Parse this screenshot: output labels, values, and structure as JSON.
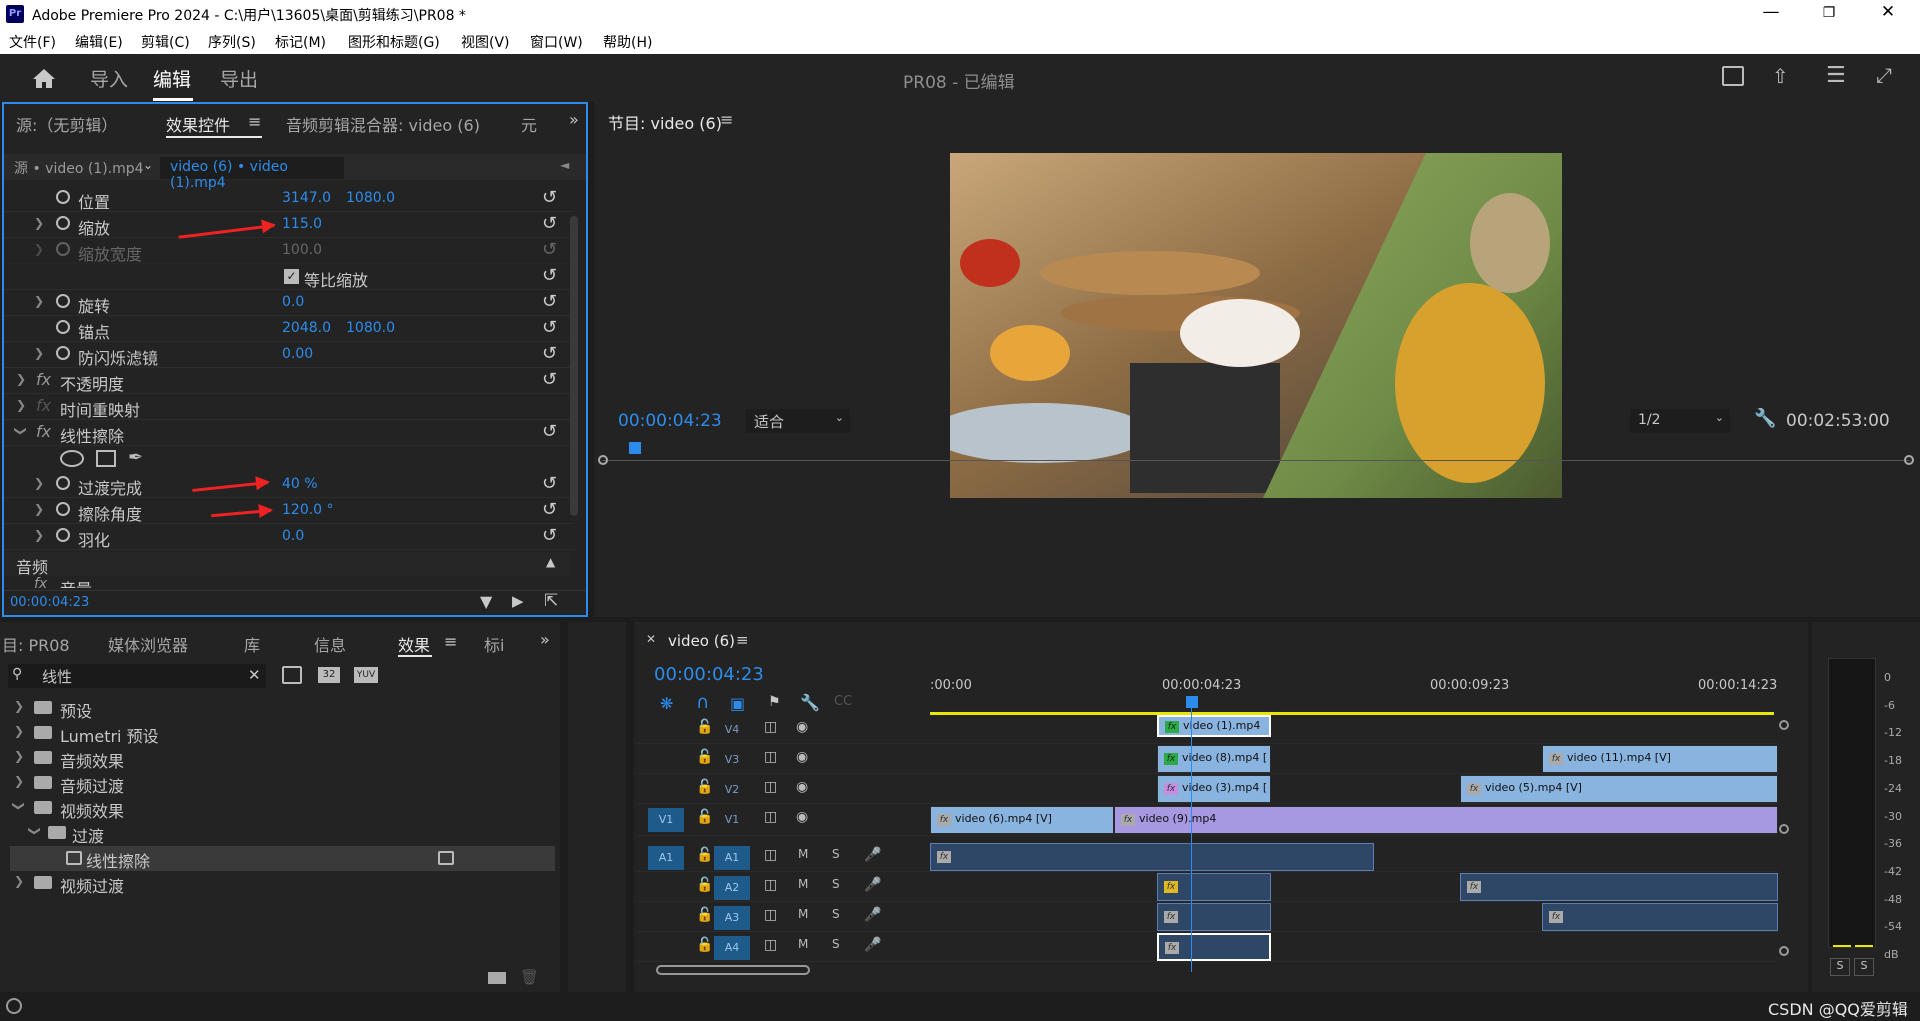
{
  "app": {
    "title": "Adobe Premiere Pro 2024 - C:\\用户\\13605\\桌面\\剪辑练习\\PR08 *",
    "logo": "Pr"
  },
  "menu": [
    "文件(F)",
    "编辑(E)",
    "剪辑(C)",
    "序列(S)",
    "标记(M)",
    "图形和标题(G)",
    "视图(V)",
    "窗口(W)",
    "帮助(H)"
  ],
  "workspace": {
    "tabs": [
      "导入",
      "编辑",
      "导出"
    ],
    "active": "编辑",
    "doc_title": "PR08 - 已编辑"
  },
  "effect_controls": {
    "tabs": [
      "源:（无剪辑）",
      "效果控件",
      "音频剪辑混合器: video (6)",
      "元"
    ],
    "source_clip": "源 • video (1).mp4",
    "target_clip": "video (6) • video (1).mp4",
    "properties": [
      {
        "name": "位置",
        "v1": "3147.0",
        "v2": "1080.0"
      },
      {
        "name": "缩放",
        "v1": "115.0",
        "v2": ""
      },
      {
        "name": "缩放宽度",
        "v1": "100.0",
        "v2": ""
      },
      {
        "name": "等比缩放",
        "v1": "",
        "v2": ""
      },
      {
        "name": "旋转",
        "v1": "0.0",
        "v2": ""
      },
      {
        "name": "锚点",
        "v1": "2048.0",
        "v2": "1080.0"
      },
      {
        "name": "防闪烁滤镜",
        "v1": "0.00",
        "v2": ""
      }
    ],
    "effects": [
      "不透明度",
      "时间重映射",
      "线性擦除"
    ],
    "wipe_props": [
      {
        "name": "过渡完成",
        "value": "40 %"
      },
      {
        "name": "擦除角度",
        "value": "120.0 °"
      },
      {
        "name": "羽化",
        "value": "0.0"
      }
    ],
    "audio_label": "音频",
    "audio_item": "音量",
    "timecode": "00:00:04:23"
  },
  "program": {
    "title": "节目: video (6)",
    "timecode": "00:00:04:23",
    "fit": "适合",
    "resolution": "1/2",
    "duration": "00:02:53:00"
  },
  "project": {
    "tabs": [
      "目: PR08",
      "媒体浏览器",
      "库",
      "信息",
      "效果",
      "标i"
    ],
    "search": "线性",
    "tree": [
      {
        "label": "预设",
        "indent": 0
      },
      {
        "label": "Lumetri 预设",
        "indent": 0
      },
      {
        "label": "音频效果",
        "indent": 0
      },
      {
        "label": "音频过渡",
        "indent": 0
      },
      {
        "label": "视频效果",
        "indent": 0
      },
      {
        "label": "过渡",
        "indent": 1
      },
      {
        "label": "线性擦除",
        "indent": 2
      },
      {
        "label": "视频过渡",
        "indent": 0
      }
    ],
    "badges": [
      "32",
      "YUV"
    ]
  },
  "timeline": {
    "sequence": "video (6)",
    "timecode": "00:00:04:23",
    "ruler": [
      ":00:00",
      "00:00:04:23",
      "00:00:09:23",
      "00:00:14:23"
    ],
    "tracks": [
      "V4",
      "V3",
      "V2",
      "V1",
      "A1",
      "A2",
      "A3",
      "A4"
    ],
    "clips": {
      "v4a": "video (1).mp4",
      "v3a": "video (8).mp4 [",
      "v3b": "video (11).mp4 [V]",
      "v2a": "video (3).mp4 [",
      "v2b": "video (5).mp4 [V]",
      "v1a": "video (6).mp4 [V]",
      "v1b": "video (9).mp4"
    },
    "m": "M",
    "s": "S"
  },
  "meter": {
    "scale": [
      "0",
      "-6",
      "-12",
      "-18",
      "-24",
      "-30",
      "-36",
      "-42",
      "-48",
      "-54",
      "dB"
    ],
    "solo": [
      "S",
      "S"
    ]
  },
  "watermark": "CSDN @QQ爱剪辑",
  "colors": {
    "accent": "#2d8ceb",
    "video_clip": "#8ab4e0",
    "selected_clip": "#a798e2",
    "arrow": "#e22222"
  }
}
